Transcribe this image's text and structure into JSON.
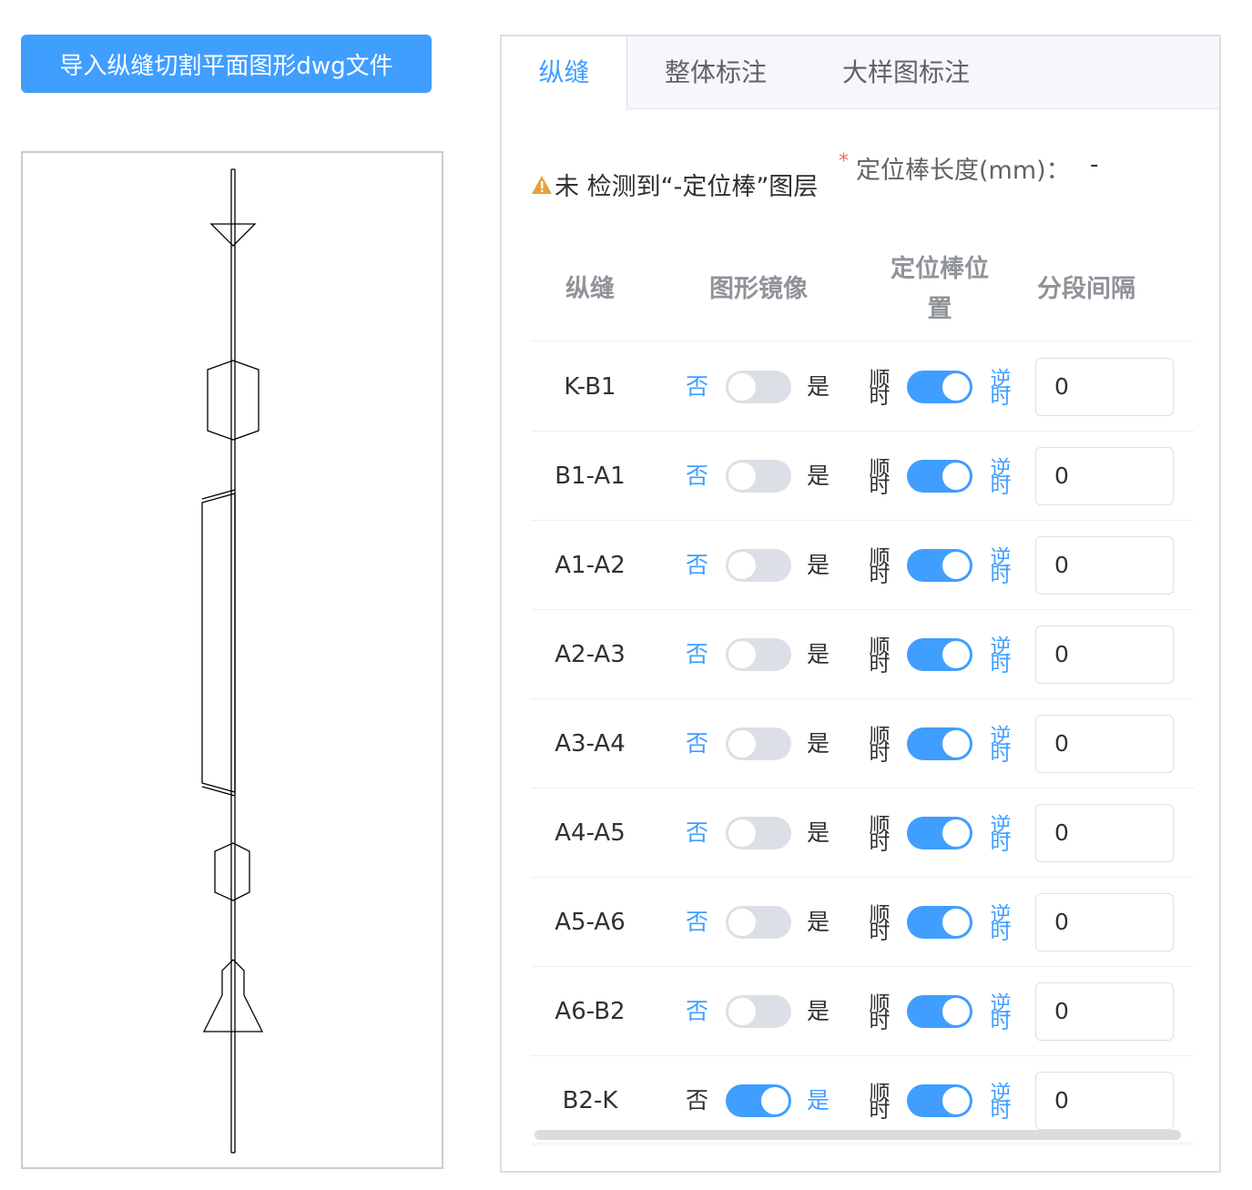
{
  "import_button": {
    "label": "导入纵缝切割平面图形dwg文件"
  },
  "tabs": [
    {
      "label": "纵缝",
      "active": true
    },
    {
      "label": "整体标注",
      "active": false
    },
    {
      "label": "大样图标注",
      "active": false
    }
  ],
  "warning": {
    "text": "未 检测到“-定位棒”图层"
  },
  "rod_length": {
    "required_mark": "*",
    "label": "定位棒长度(mm)：",
    "value": "-"
  },
  "table": {
    "headers": {
      "seam": "纵缝",
      "mirror": "图形镜像",
      "rod_position": "定位棒位置",
      "interval": "分段间隔"
    },
    "mirror_labels": {
      "off": "否",
      "on": "是"
    },
    "direction_labels": {
      "left": "顺时",
      "right": "逆时"
    },
    "rows": [
      {
        "seam": "K-B1",
        "mirror": false,
        "counterclockwise": true,
        "interval": "0"
      },
      {
        "seam": "B1-A1",
        "mirror": false,
        "counterclockwise": true,
        "interval": "0"
      },
      {
        "seam": "A1-A2",
        "mirror": false,
        "counterclockwise": true,
        "interval": "0"
      },
      {
        "seam": "A2-A3",
        "mirror": false,
        "counterclockwise": true,
        "interval": "0"
      },
      {
        "seam": "A3-A4",
        "mirror": false,
        "counterclockwise": true,
        "interval": "0"
      },
      {
        "seam": "A4-A5",
        "mirror": false,
        "counterclockwise": true,
        "interval": "0"
      },
      {
        "seam": "A5-A6",
        "mirror": false,
        "counterclockwise": true,
        "interval": "0"
      },
      {
        "seam": "A6-B2",
        "mirror": false,
        "counterclockwise": true,
        "interval": "0"
      },
      {
        "seam": "B2-K",
        "mirror": true,
        "counterclockwise": true,
        "interval": "0"
      }
    ]
  },
  "colors": {
    "accent": "#409eff",
    "switch_off": "#dcdfe6",
    "warning": "#e6a23c",
    "required": "#f56c6c"
  }
}
